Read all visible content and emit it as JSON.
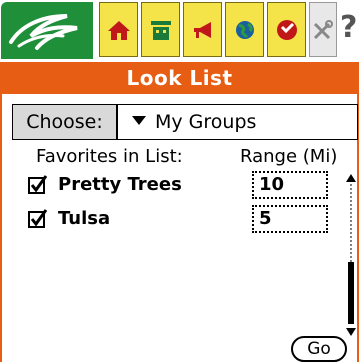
{
  "toolbar": {
    "logo": "bird-logo-icon",
    "buttons": [
      {
        "icon": "home-icon",
        "color": "#c01818"
      },
      {
        "icon": "building-icon",
        "color": "#1a7a3a"
      },
      {
        "icon": "megaphone-icon",
        "color": "#c01818"
      },
      {
        "icon": "globe-icon",
        "color": "#1a5fa0"
      },
      {
        "icon": "stop-icon",
        "color": "#c01818"
      },
      {
        "icon": "tools-icon",
        "color": "#888888"
      }
    ],
    "help_label": "?"
  },
  "title": "Look List",
  "choose": {
    "label": "Choose:",
    "value": "My Groups"
  },
  "list": {
    "favorites_header": "Favorites in List:",
    "range_header": "Range (Mi)",
    "items": [
      {
        "name": "Pretty Trees",
        "checked": true,
        "range": "10"
      },
      {
        "name": "Tulsa",
        "checked": true,
        "range": "5"
      }
    ]
  },
  "go_label": "Go",
  "colors": {
    "accent": "#e85d14",
    "toolbar": "#f4e44a",
    "logo_bg": "#1f8f3a"
  }
}
